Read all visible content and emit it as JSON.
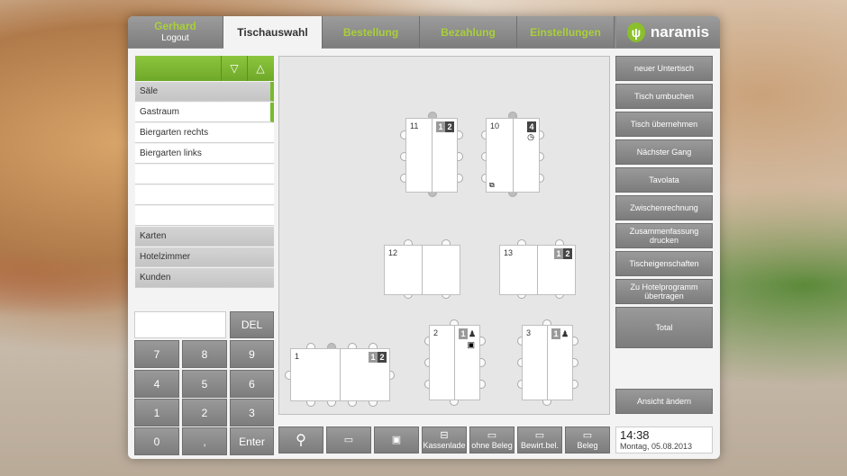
{
  "tabs": {
    "user_name": "Gerhard",
    "logout": "Logout",
    "items": [
      "Tischauswahl",
      "Bestellung",
      "Bezahlung",
      "Einstellungen"
    ],
    "logo": "naramis"
  },
  "list": {
    "up": "▽",
    "down": "△",
    "items": [
      "Säle",
      "Gastraum",
      "Biergarten rechts",
      "Biergarten links",
      "",
      "",
      "",
      "Karten",
      "Hotelzimmer",
      "Kunden"
    ]
  },
  "keypad": {
    "del": "DEL",
    "enter": "Enter",
    "keys": [
      "7",
      "8",
      "9",
      "4",
      "5",
      "6",
      "1",
      "2",
      "3",
      "0",
      ","
    ]
  },
  "tables": [
    {
      "num": "11",
      "a": "1",
      "b": "2"
    },
    {
      "num": "10",
      "a": "",
      "b": "4"
    },
    {
      "num": "12",
      "a": "",
      "b": ""
    },
    {
      "num": "13",
      "a": "1",
      "b": "2"
    },
    {
      "num": "1",
      "a": "1",
      "b": "2"
    },
    {
      "num": "2",
      "a": "1",
      "b": ""
    },
    {
      "num": "3",
      "a": "1",
      "b": ""
    }
  ],
  "right_buttons": [
    "neuer Untertisch",
    "Tisch umbuchen",
    "Tisch übernehmen",
    "Nächster Gang",
    "Tavolata",
    "Zwischenrechnung",
    "Zusammenfassung drucken",
    "Tischeigenschaften",
    "Zu Hotelprogramm übertragen",
    "Total",
    "Ansicht ändern"
  ],
  "toolbar": [
    "Kassenlade",
    "ohne Beleg",
    "Bewirt.bel.",
    "Beleg"
  ],
  "clock": {
    "time": "14:38",
    "date": "Montag, 05.08.2013"
  }
}
